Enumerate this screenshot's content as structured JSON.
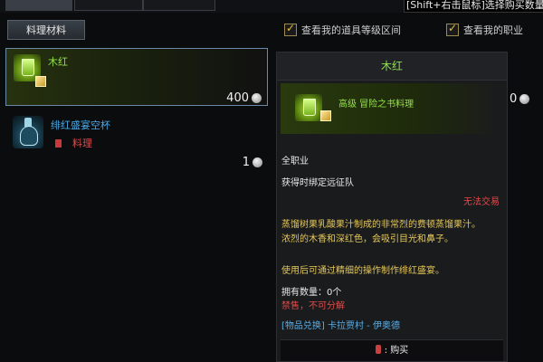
{
  "hint": "[Shift+右击鼠标]选择购买数量",
  "category_button": "料理材料",
  "filters": [
    {
      "label": "查看我的道具等级区间",
      "checked": true
    },
    {
      "label": "查看我的职业",
      "checked": true
    }
  ],
  "items": [
    {
      "name": "木红",
      "price": "400",
      "selected": true,
      "name_color": "#8fe04a"
    },
    {
      "name": "绯红盛宴空杯",
      "tag": "料理",
      "price": "1",
      "name_color": "#49a8e6"
    }
  ],
  "tooltip": {
    "title": "木红",
    "grade": "高级 冒险之书料理",
    "job": "全职业",
    "bind": "获得时绑定远征队",
    "no_trade": "无法交易",
    "desc_line1": "蒸馏树果乳酸果汁制成的非常烈的费顿蒸馏果汁。",
    "desc_line2": "浓烈的木香和深红色，会吸引目光和鼻子。",
    "use": "使用后可通过精细的操作制作绯红盛宴。",
    "owned": "拥有数量：0个",
    "ban": "禁售，不可分解",
    "exchange": "[物品兑换] 卡拉贾村 - 伊奥德",
    "buy_label": ": 购买"
  },
  "edge_price_fragment": "0"
}
